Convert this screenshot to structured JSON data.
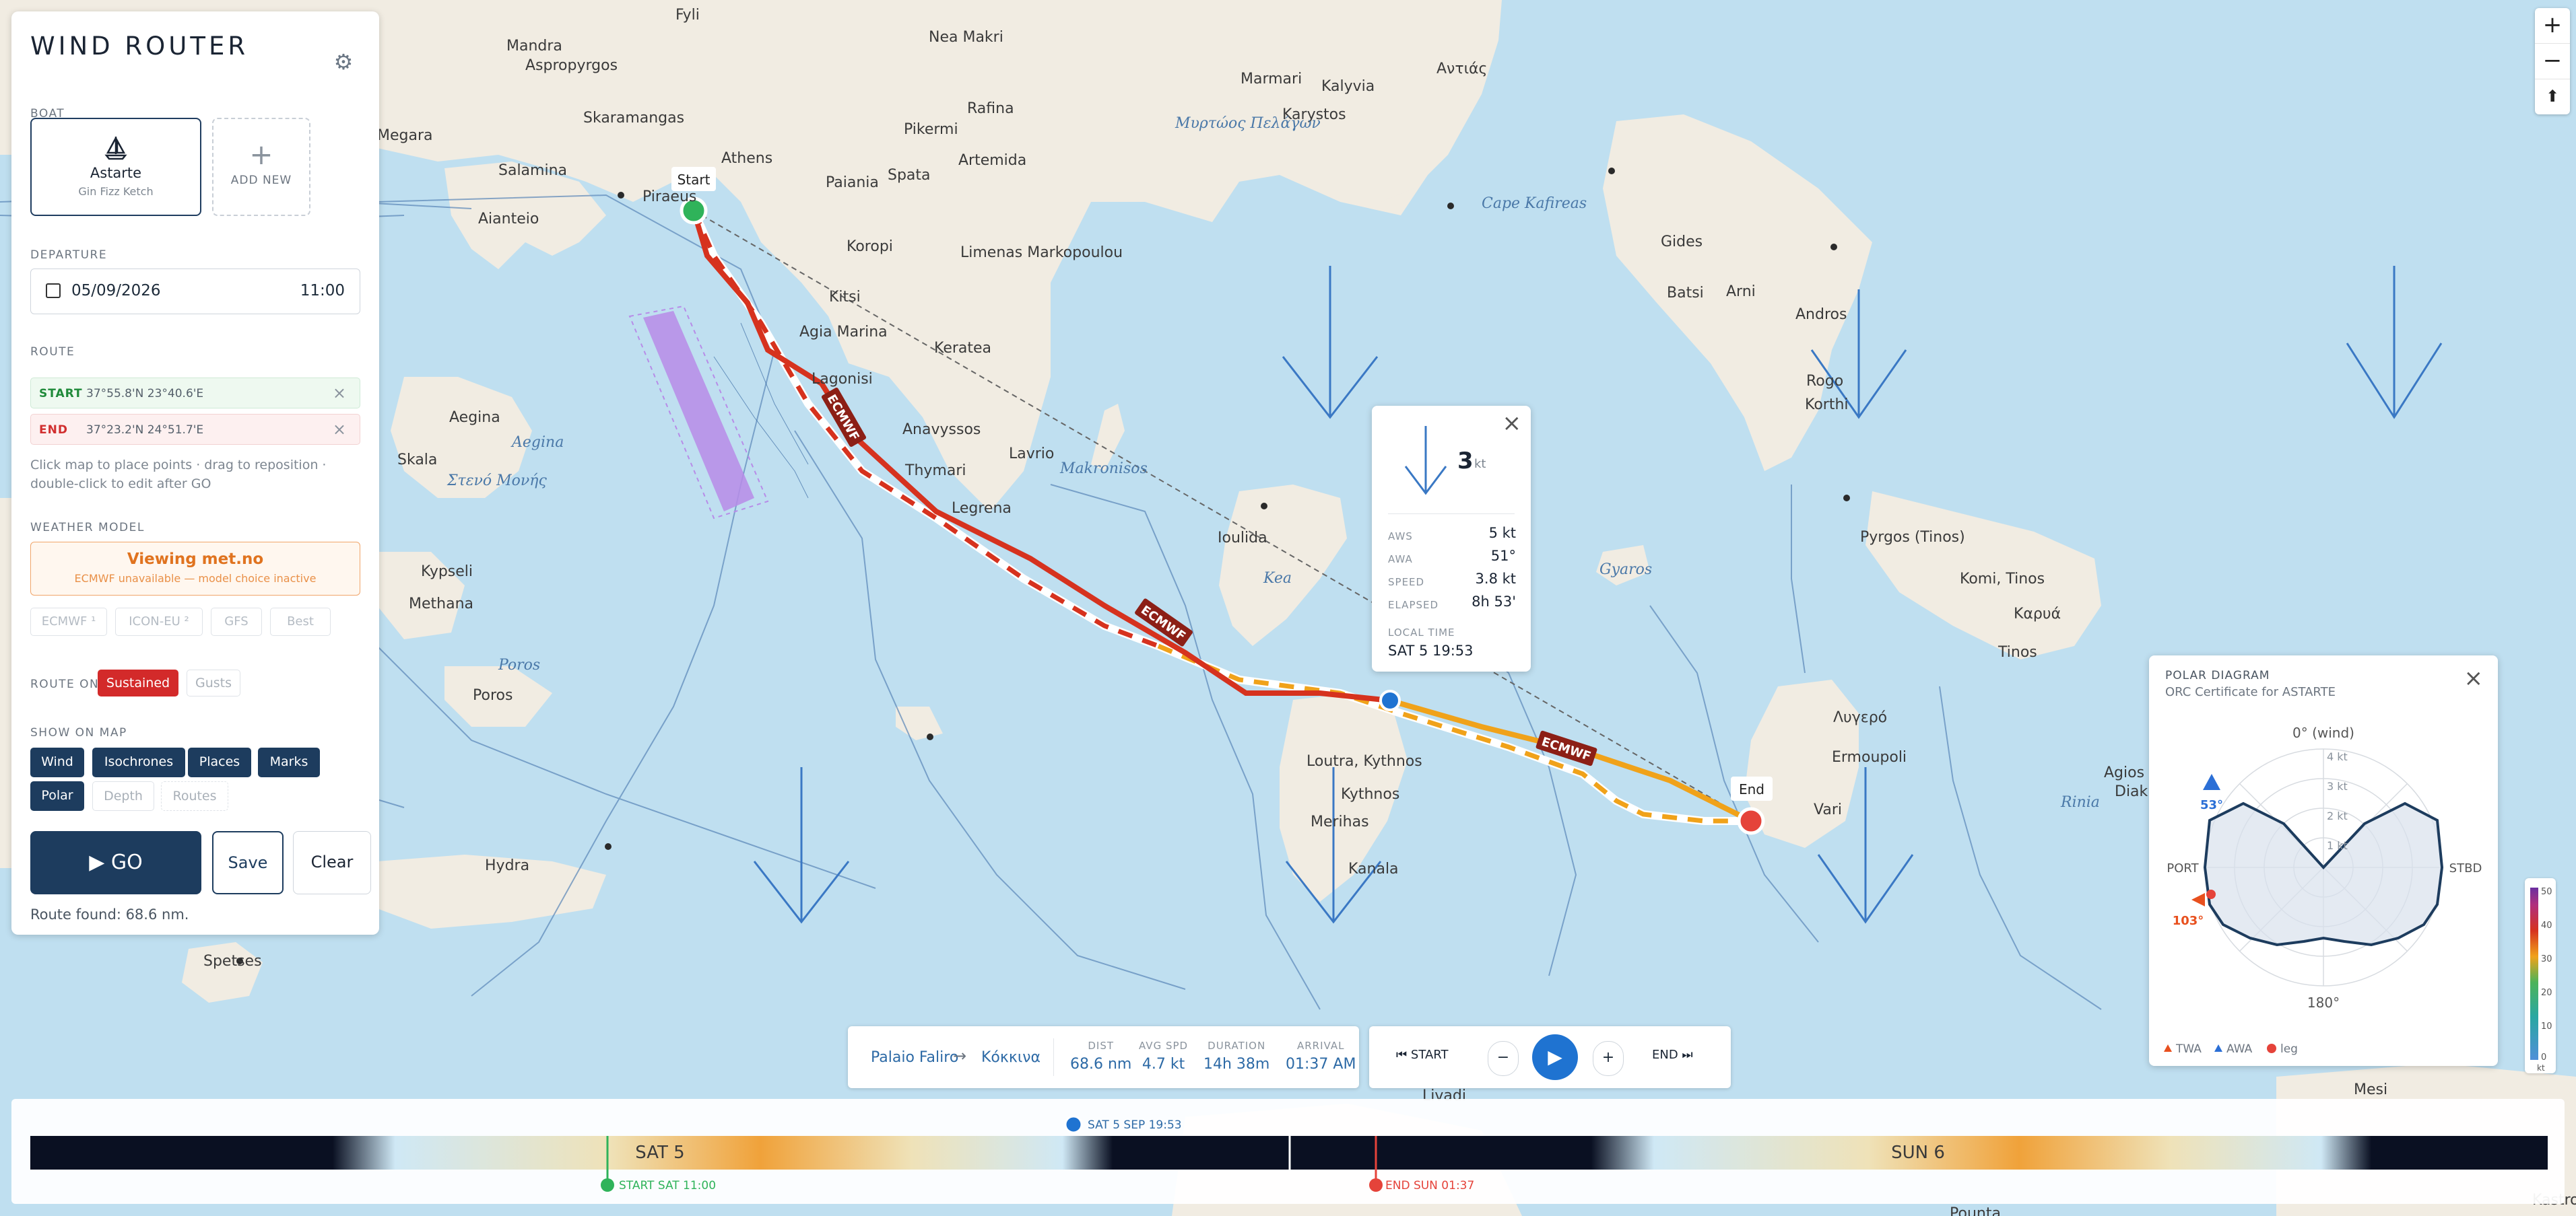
{
  "panel": {
    "title": "WIND ROUTER",
    "boat_section": "BOAT",
    "boat_name": "Astarte",
    "boat_type": "Gin Fizz Ketch",
    "add_new": "ADD NEW",
    "departure_section": "DEPARTURE",
    "departure_date": "05/09/2026",
    "departure_time": "11:00",
    "route_section": "ROUTE",
    "start_label": "START",
    "start_coords": "37°55.8'N 23°40.6'E",
    "end_label": "END",
    "end_coords": "37°23.2'N 24°51.7'E",
    "hint": "Click map to place points · drag to reposition · double-click to edit after GO",
    "weather_section": "WEATHER MODEL",
    "weather_viewing": "Viewing met.no",
    "weather_note": "ECMWF unavailable — model choice inactive",
    "models": [
      "ECMWF ¹",
      "ICON-EU ²",
      "GFS",
      "Best"
    ],
    "route_on_label": "ROUTE ON",
    "route_on": [
      "Sustained",
      "Gusts"
    ],
    "show_on_map_label": "SHOW ON MAP",
    "layers": [
      "Wind",
      "Isochrones",
      "Places",
      "Marks",
      "Polar",
      "Depth",
      "Routes"
    ],
    "go_label": "GO",
    "save_label": "Save",
    "clear_label": "Clear",
    "route_found": "Route found: 68.6 nm."
  },
  "map": {
    "places": [
      "Fyli",
      "Mandra",
      "Aspropyrgos",
      "Megara",
      "Skaramangas",
      "Salamina",
      "Aianteio",
      "Piraeus",
      "Athens",
      "Nea Makri",
      "Rafina",
      "Pikermi",
      "Artemida",
      "Paiania",
      "Spata",
      "Koropi",
      "Limenas Markopoulou",
      "Kitsi",
      "Agia Marina",
      "Keratea",
      "Lagonisi",
      "Anavyssos",
      "Lavrio",
      "Thymari",
      "Legrena",
      "Aegina",
      "Skala",
      "Kypseli",
      "Methana",
      "Poros",
      "Hydra",
      "Spetses",
      "Ioulida",
      "Loutra, Kythnos",
      "Kythnos",
      "Merihas",
      "Kanala",
      "Marmari",
      "Kalyvia",
      "Karystos",
      "Αντιάς",
      "Gides",
      "Batsi",
      "Arni",
      "Andros",
      "Rogo",
      "Korthi",
      "Pyrgos (Tinos)",
      "Komi, Tinos",
      "Καρυά",
      "Tinos",
      "Λυγερό",
      "Ermoupoli",
      "Vari",
      "Agios",
      "Diak",
      "Mesi",
      "Livadi",
      "Pounta",
      "Kastro"
    ],
    "seas": [
      "Μυρτώος Πελάγων",
      "Cape Kafireas",
      "Aegina",
      "Στενό Μονής",
      "Poros",
      "Makronisos",
      "Kea",
      "Gyaros",
      "Rinia"
    ],
    "start_marker": "Start",
    "end_marker": "End",
    "route_model_label": "ECMWF"
  },
  "popup": {
    "tws_value": "3",
    "tws_unit": "kt",
    "rows": [
      {
        "label": "AWS",
        "value": "5 kt"
      },
      {
        "label": "AWA",
        "value": "51°"
      },
      {
        "label": "SPEED",
        "value": "3.8 kt"
      },
      {
        "label": "ELAPSED",
        "value": "8h 53'"
      }
    ],
    "local_time_label": "LOCAL TIME",
    "local_time": "SAT 5 19:53"
  },
  "polar": {
    "title": "POLAR DIAGRAM",
    "subtitle": "ORC Certificate for ASTARTE",
    "top_label": "0° (wind)",
    "bottom_label": "180°",
    "port_label": "PORT",
    "stbd_label": "STBD",
    "rings": [
      "4 kt",
      "3 kt",
      "2 kt",
      "1 kt"
    ],
    "awa_value": "53°",
    "twa_value": "103°",
    "legend": [
      "TWA",
      "AWA",
      "leg"
    ]
  },
  "stats": {
    "from": "Palaio Faliro",
    "to": "Κόκκινα",
    "dist_label": "DIST",
    "dist": "68.6 nm",
    "avg_label": "AVG SPD",
    "avg": "4.7 kt",
    "dur_label": "DURATION",
    "dur": "14h 38m",
    "arr_label": "ARRIVAL",
    "arr": "01:37 AM"
  },
  "playback": {
    "start_label": "START",
    "end_label": "END",
    "minus": "−",
    "plus": "+"
  },
  "timeline": {
    "day1": "SAT 5",
    "day2": "SUN 6",
    "cursor": "SAT 5 SEP 19:53",
    "start_tag": "START SAT 11:00",
    "end_tag": "END SUN 01:37"
  },
  "scale": {
    "ticks": [
      "50",
      "40",
      "30",
      "20",
      "10",
      "0"
    ],
    "unit": "kt"
  },
  "colors": {
    "navy": "#1d3c5e",
    "route_red": "#d6321e",
    "route_orange": "#f0a21a",
    "start_green": "#2fb35a",
    "end_red": "#e5433a",
    "cursor_blue": "#1f73d1"
  }
}
